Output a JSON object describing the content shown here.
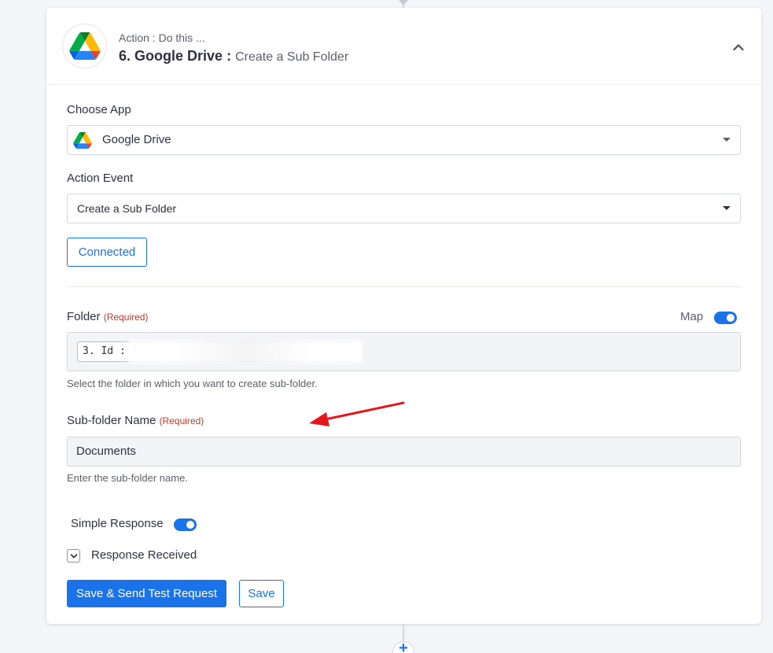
{
  "step": {
    "subtitle": "Action : Do this ...",
    "app_title": "6. Google Drive",
    "separator": ":",
    "event_title": "Create a Sub Folder"
  },
  "choose_app": {
    "label": "Choose App",
    "value": "Google Drive",
    "icon": "google-drive-icon"
  },
  "action_event": {
    "label": "Action Event",
    "value": "Create a Sub Folder"
  },
  "connection": {
    "button_label": "Connected"
  },
  "folder": {
    "label": "Folder",
    "required": "(Required)",
    "map_label": "Map",
    "map_on": true,
    "token": "3. Id : 1",
    "help": "Select the folder in which you want to create sub-folder."
  },
  "subfolder": {
    "label": "Sub-folder Name",
    "required": "(Required)",
    "value": "Documents",
    "help": "Enter the sub-folder name."
  },
  "simple_response": {
    "label": "Simple Response",
    "on": true
  },
  "response_received": {
    "label": "Response Received"
  },
  "buttons": {
    "save_send": "Save & Send Test Request",
    "save": "Save"
  },
  "add_step": {
    "glyph": "+"
  },
  "colors": {
    "accent": "#1a73e8",
    "required": "#c0392b",
    "annotation_arrow": "#e8141a"
  }
}
